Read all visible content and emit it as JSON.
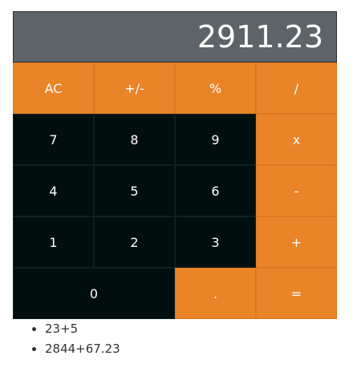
{
  "display": {
    "value": "2911.23"
  },
  "keys": {
    "ac": "AC",
    "sign": "+/-",
    "percent": "%",
    "divide": "/",
    "seven": "7",
    "eight": "8",
    "nine": "9",
    "multiply": "x",
    "four": "4",
    "five": "5",
    "six": "6",
    "subtract": "-",
    "one": "1",
    "two": "2",
    "three": "3",
    "add": "+",
    "zero": "0",
    "decimal": ".",
    "equals": "="
  },
  "history": [
    "23+5",
    "2844+67.23"
  ],
  "colors": {
    "operator": "#e98428",
    "digit": "#010e0e",
    "display": "#5d6469"
  }
}
